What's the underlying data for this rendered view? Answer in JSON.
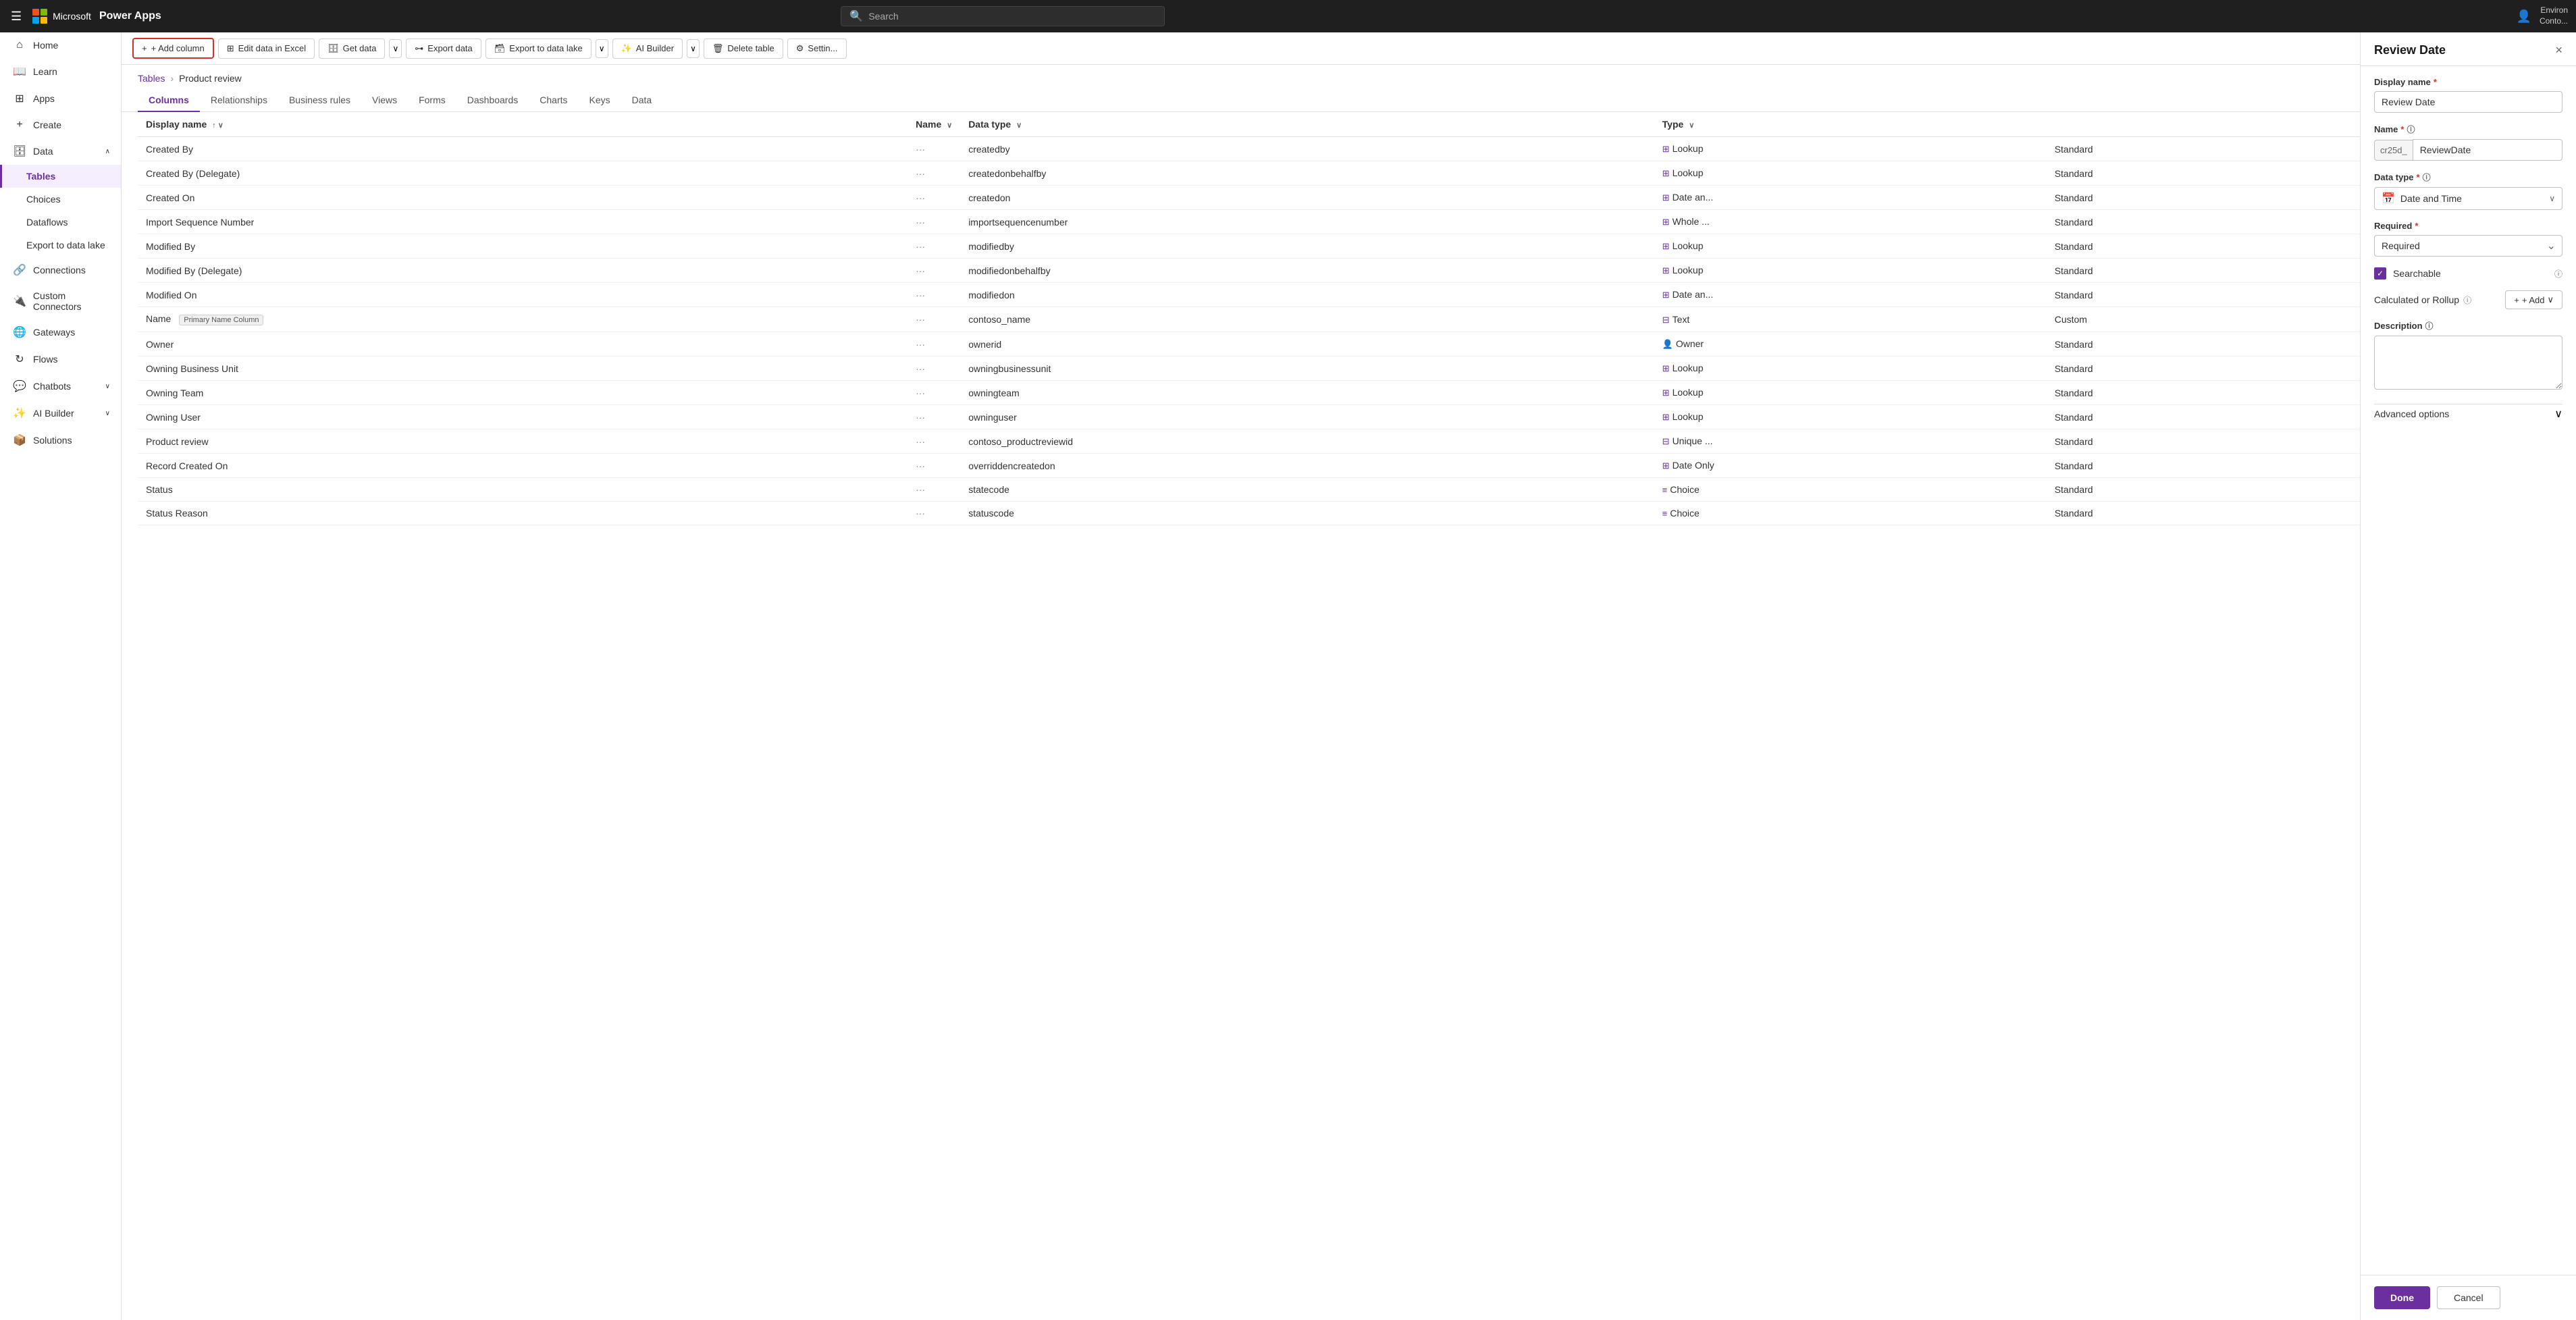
{
  "topbar": {
    "hamburger": "☰",
    "app_name": "Power Apps",
    "search_placeholder": "Search",
    "env_label": "Environ",
    "user_label": "Conto..."
  },
  "sidebar": {
    "items": [
      {
        "id": "home",
        "label": "Home",
        "icon": "⌂"
      },
      {
        "id": "learn",
        "label": "Learn",
        "icon": "📖"
      },
      {
        "id": "apps",
        "label": "Apps",
        "icon": "⊞"
      },
      {
        "id": "create",
        "label": "Create",
        "icon": "+"
      },
      {
        "id": "data",
        "label": "Data",
        "icon": "🗄",
        "expanded": true,
        "subitems": [
          {
            "id": "tables",
            "label": "Tables",
            "active": true
          },
          {
            "id": "choices",
            "label": "Choices"
          },
          {
            "id": "dataflows",
            "label": "Dataflows"
          },
          {
            "id": "export",
            "label": "Export to data lake"
          }
        ]
      },
      {
        "id": "connections",
        "label": "Connections",
        "icon": "🔗"
      },
      {
        "id": "custom-connectors",
        "label": "Custom Connectors",
        "icon": "🔌"
      },
      {
        "id": "gateways",
        "label": "Gateways",
        "icon": "🌐"
      },
      {
        "id": "flows",
        "label": "Flows",
        "icon": "↻"
      },
      {
        "id": "chatbots",
        "label": "Chatbots",
        "icon": "💬",
        "hasChevron": true
      },
      {
        "id": "ai-builder",
        "label": "AI Builder",
        "icon": "✨",
        "hasChevron": true
      },
      {
        "id": "solutions",
        "label": "Solutions",
        "icon": "📦"
      }
    ]
  },
  "toolbar": {
    "add_column": "+ Add column",
    "edit_excel": "Edit data in Excel",
    "get_data": "Get data",
    "export_data": "Export data",
    "export_lake": "Export to data lake",
    "ai_builder": "AI Builder",
    "delete_table": "Delete table",
    "settings": "Settin..."
  },
  "breadcrumb": {
    "parent": "Tables",
    "separator": "›",
    "current": "Product review"
  },
  "tabs": [
    {
      "id": "columns",
      "label": "Columns",
      "active": true
    },
    {
      "id": "relationships",
      "label": "Relationships"
    },
    {
      "id": "business-rules",
      "label": "Business rules"
    },
    {
      "id": "views",
      "label": "Views"
    },
    {
      "id": "forms",
      "label": "Forms"
    },
    {
      "id": "dashboards",
      "label": "Dashboards"
    },
    {
      "id": "charts",
      "label": "Charts"
    },
    {
      "id": "keys",
      "label": "Keys"
    },
    {
      "id": "data",
      "label": "Data"
    }
  ],
  "table": {
    "headers": [
      "Display name",
      "Name",
      "Data type",
      "Type"
    ],
    "rows": [
      {
        "display_name": "Created By",
        "name": "createdby",
        "data_type": "Lookup",
        "type": "Standard",
        "type_icon": "⊞"
      },
      {
        "display_name": "Created By (Delegate)",
        "name": "createdonbehalfby",
        "data_type": "Lookup",
        "type": "Standard",
        "type_icon": "⊞"
      },
      {
        "display_name": "Created On",
        "name": "createdon",
        "data_type": "Date an...",
        "type": "Standard",
        "type_icon": "⊞"
      },
      {
        "display_name": "Import Sequence Number",
        "name": "importsequencenumber",
        "data_type": "Whole ...",
        "type": "Standard",
        "type_icon": "⊞"
      },
      {
        "display_name": "Modified By",
        "name": "modifiedby",
        "data_type": "Lookup",
        "type": "Standard",
        "type_icon": "⊞"
      },
      {
        "display_name": "Modified By (Delegate)",
        "name": "modifiedonbehalfby",
        "data_type": "Lookup",
        "type": "Standard",
        "type_icon": "⊞"
      },
      {
        "display_name": "Modified On",
        "name": "modifiedon",
        "data_type": "Date an...",
        "type": "Standard",
        "type_icon": "⊞"
      },
      {
        "display_name": "Name",
        "name": "contoso_name",
        "data_type": "Text",
        "type": "Custom",
        "badge": "Primary Name Column",
        "type_icon": "⊟"
      },
      {
        "display_name": "Owner",
        "name": "ownerid",
        "data_type": "Owner",
        "type": "Standard",
        "type_icon": "👤"
      },
      {
        "display_name": "Owning Business Unit",
        "name": "owningbusinessunit",
        "data_type": "Lookup",
        "type": "Standard",
        "type_icon": "⊞"
      },
      {
        "display_name": "Owning Team",
        "name": "owningteam",
        "data_type": "Lookup",
        "type": "Standard",
        "type_icon": "⊞"
      },
      {
        "display_name": "Owning User",
        "name": "owninguser",
        "data_type": "Lookup",
        "type": "Standard",
        "type_icon": "⊞"
      },
      {
        "display_name": "Product review",
        "name": "contoso_productreviewid",
        "data_type": "Unique ...",
        "type": "Standard",
        "type_icon": "⊟"
      },
      {
        "display_name": "Record Created On",
        "name": "overriddencreatedon",
        "data_type": "Date Only",
        "type": "Standard",
        "type_icon": "⊞"
      },
      {
        "display_name": "Status",
        "name": "statecode",
        "data_type": "Choice",
        "type": "Standard",
        "type_icon": "≡"
      },
      {
        "display_name": "Status Reason",
        "name": "statuscode",
        "data_type": "Choice",
        "type": "Standard",
        "type_icon": "≡"
      }
    ]
  },
  "panel": {
    "title": "Review Date",
    "close_icon": "×",
    "display_name_label": "Display name",
    "display_name_value": "Review Date",
    "name_label": "Name",
    "name_prefix": "cr25d_",
    "name_value": "ReviewDate",
    "data_type_label": "Data type",
    "data_type_value": "Date and Time",
    "data_type_icon": "📅",
    "required_label": "Required",
    "required_value": "Required",
    "searchable_label": "Searchable",
    "searchable_checked": true,
    "calc_label": "Calculated or Rollup",
    "add_label": "+ Add",
    "description_label": "Description",
    "description_placeholder": "",
    "advanced_label": "Advanced options",
    "done_label": "Done",
    "cancel_label": "Cancel"
  }
}
